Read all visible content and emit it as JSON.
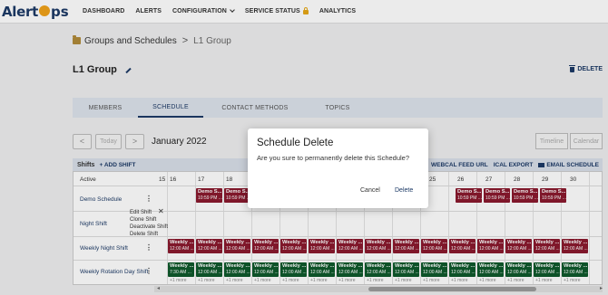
{
  "app": {
    "logo_text_1": "Alert",
    "logo_text_2": "ps",
    "nav": [
      "DASHBOARD",
      "ALERTS",
      "CONFIGURATION",
      "SERVICE STATUS",
      "ANALYTICS"
    ]
  },
  "breadcrumb": {
    "parent": "Groups and Schedules",
    "separator": ">",
    "current": "L1 Group"
  },
  "page": {
    "title": "L1 Group",
    "delete_label": "DELETE"
  },
  "tabs": [
    {
      "label": "MEMBERS",
      "active": false
    },
    {
      "label": "SCHEDULE",
      "active": true
    },
    {
      "label": "CONTACT METHODS",
      "active": false
    },
    {
      "label": "TOPICS",
      "active": false
    }
  ],
  "calendar": {
    "prev": "<",
    "today_label": "Today",
    "next": ">",
    "month": "January 2022",
    "views": [
      "Timeline",
      "Calendar"
    ]
  },
  "shifts_bar": {
    "label": "Shifts",
    "add_label": "+ ADD SHIFT",
    "webcal": "WEBCAL FEED URL",
    "ical": "ICAL EXPORT",
    "email": "EMAIL SCHEDULE"
  },
  "grid": {
    "active_label": "Active",
    "days": [
      "15",
      "16",
      "17",
      "18",
      "25",
      "26",
      "27",
      "28",
      "29",
      "30"
    ],
    "rows": [
      "Demo Schedule",
      "Night Shift",
      "Weekly Night Shift",
      "Weekly Rotation Day Shift"
    ],
    "context_menu": [
      "Edit Shift",
      "Clone Shift",
      "Deactivate Shift",
      "Delete Shift"
    ],
    "close": "✕",
    "kebab": "⋮",
    "demo_block": {
      "title": "Demo S...",
      "time": "10:59 PM ..."
    },
    "night_block": {
      "title": "Weekly ...",
      "time": "12:00 AM ..."
    },
    "day_block": {
      "title": "Weekly ...",
      "time_first": "7:30 AM ...",
      "time": "12:00 AM ..."
    },
    "more_label": "+1 more"
  },
  "modal": {
    "title": "Schedule Delete",
    "body": "Are you sure to permanently delete this Schedule?",
    "cancel_label": "Cancel",
    "delete_label": "Delete"
  },
  "colors": {
    "brand": "#1d3a66",
    "accent": "#f0a21a",
    "demo_block": "#8a1a2e",
    "night_block": "#8a1a2e",
    "day_block": "#0f5a2c"
  }
}
